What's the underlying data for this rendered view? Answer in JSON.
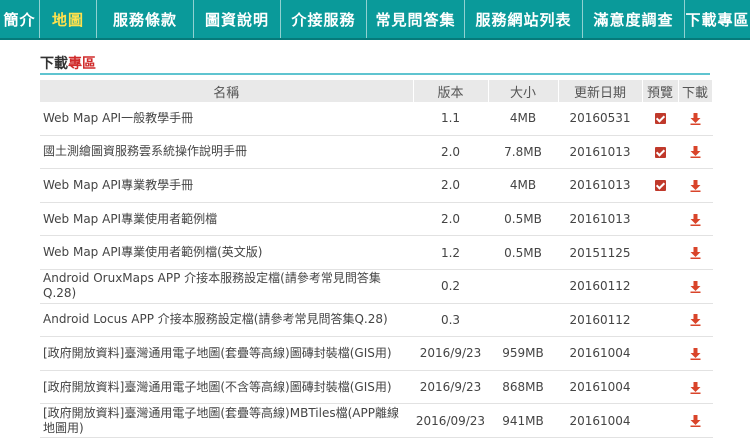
{
  "nav": {
    "items": [
      "簡介",
      "地圖",
      "服務條款",
      "圖資說明",
      "介接服務",
      "常見問答集",
      "服務網站列表",
      "滿意度調查",
      "下載專區"
    ]
  },
  "section": {
    "title_prefix": "下載",
    "title_accent": "專區"
  },
  "table": {
    "headers": {
      "name": "名稱",
      "version": "版本",
      "size": "大小",
      "date": "更新日期",
      "preview": "預覽",
      "download": "下載"
    },
    "rows": [
      {
        "name": "Web Map API一般教學手冊",
        "version": "1.1",
        "size": "4MB",
        "date": "20160531",
        "preview": true
      },
      {
        "name": "國土測繪圖資服務雲系統操作說明手冊",
        "version": "2.0",
        "size": "7.8MB",
        "date": "20161013",
        "preview": true
      },
      {
        "name": "Web Map API專業教學手冊",
        "version": "2.0",
        "size": "4MB",
        "date": "20161013",
        "preview": true
      },
      {
        "name": "Web Map API專業使用者範例檔",
        "version": "2.0",
        "size": "0.5MB",
        "date": "20161013",
        "preview": false
      },
      {
        "name": "Web Map API專業使用者範例檔(英文版)",
        "version": "1.2",
        "size": "0.5MB",
        "date": "20151125",
        "preview": false
      },
      {
        "name": "Android OruxMaps APP 介接本服務設定檔(請參考常見問答集Q.28)",
        "version": "0.2",
        "size": "",
        "date": "20160112",
        "preview": false
      },
      {
        "name": "Android Locus APP 介接本服務設定檔(請參考常見問答集Q.28)",
        "version": "0.3",
        "size": "",
        "date": "20160112",
        "preview": false
      },
      {
        "name": "[政府開放資料]臺灣通用電子地圖(套疊等高線)圖磚封裝檔(GIS用)",
        "version": "2016/9/23",
        "size": "959MB",
        "date": "20161004",
        "preview": false
      },
      {
        "name": "[政府開放資料]臺灣通用電子地圖(不含等高線)圖磚封裝檔(GIS用)",
        "version": "2016/9/23",
        "size": "868MB",
        "date": "20161004",
        "preview": false
      },
      {
        "name": "[政府開放資料]臺灣通用電子地圖(套疊等高線)MBTiles檔(APP離線地圖用)",
        "version": "2016/09/23",
        "size": "941MB",
        "date": "20161004",
        "preview": false
      }
    ]
  },
  "colors": {
    "nav_bg": "#0a9a9a",
    "nav_active": "#ffe14d",
    "accent_red": "#d02a2a",
    "rule": "#5fc4d0"
  }
}
